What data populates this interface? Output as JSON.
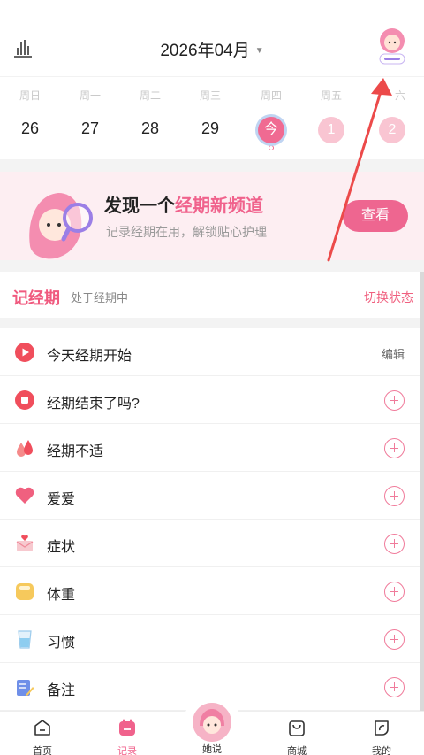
{
  "header": {
    "month_title": "2026年04月",
    "stats_icon": "bar-chart-icon",
    "avatar_icon": "profile-avatar-icon"
  },
  "week": {
    "days": [
      {
        "name": "周日",
        "date": "26"
      },
      {
        "name": "周一",
        "date": "27"
      },
      {
        "name": "周二",
        "date": "28"
      },
      {
        "name": "周三",
        "date": "29"
      },
      {
        "name": "周四",
        "date": "今"
      },
      {
        "name": "周五",
        "date": "1"
      },
      {
        "name": "六",
        "date": "2"
      }
    ]
  },
  "banner": {
    "title_prefix": "发现一个",
    "title_highlight": "经期新频道",
    "subtitle": "记录经期在用，解锁贴心护理",
    "button_label": "查看"
  },
  "section": {
    "title": "记经期",
    "status": "处于经期中",
    "switch_label": "切换状态"
  },
  "list": {
    "rows": [
      {
        "label": "今天经期开始",
        "action": "编辑",
        "icon": "play-icon"
      },
      {
        "label": "经期结束了吗?",
        "icon": "stop-icon"
      },
      {
        "label": "经期不适",
        "icon": "drops-icon"
      },
      {
        "label": "爱爱",
        "icon": "heart-icon"
      },
      {
        "label": "症状",
        "icon": "envelope-heart-icon"
      },
      {
        "label": "体重",
        "icon": "scale-icon"
      },
      {
        "label": "习惯",
        "icon": "water-glass-icon"
      },
      {
        "label": "备注",
        "icon": "note-pencil-icon"
      }
    ]
  },
  "tabbar": {
    "tabs": [
      {
        "label": "首页",
        "icon": "home-icon"
      },
      {
        "label": "记录",
        "icon": "calendar-icon"
      },
      {
        "label": "她说",
        "icon": "character-avatar-icon"
      },
      {
        "label": "商城",
        "icon": "shopping-bag-icon"
      },
      {
        "label": "我的",
        "icon": "profile-leaf-icon"
      }
    ],
    "active_tab": "记录"
  },
  "colors": {
    "accent_pink": "#f0628c",
    "section_red": "#f05a7f",
    "banner_bg": "#fdeef2"
  }
}
